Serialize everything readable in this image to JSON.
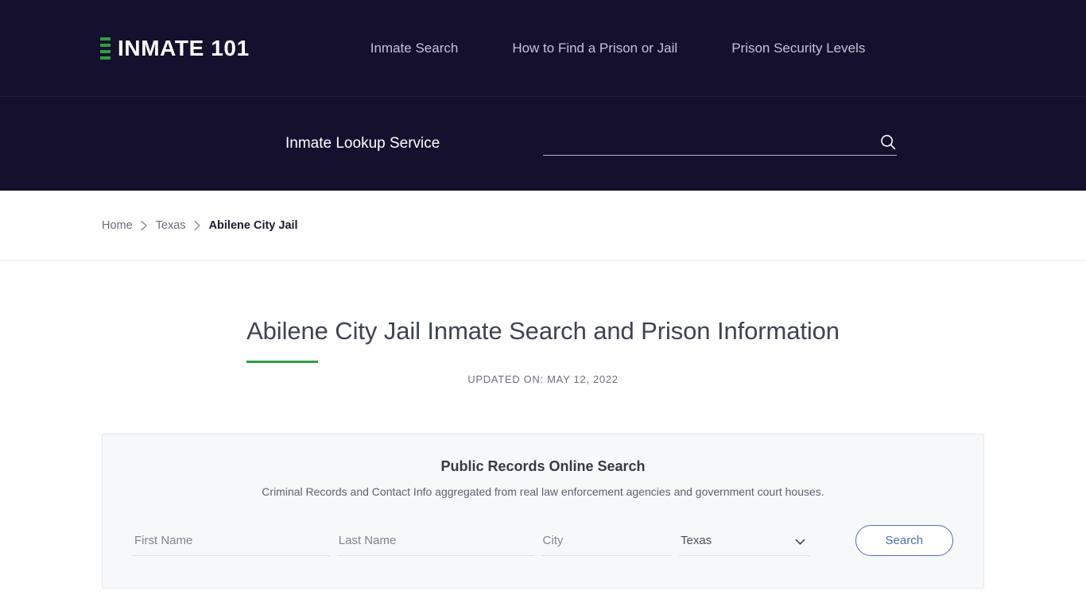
{
  "header": {
    "brand_text": "INMATE 101",
    "brand_icon": "bars-logo-icon",
    "nav": [
      {
        "label": "Inmate Search"
      },
      {
        "label": "How to Find a Prison or Jail"
      },
      {
        "label": "Prison Security Levels"
      }
    ]
  },
  "search_strip": {
    "label": "Inmate Lookup Service",
    "input_value": "",
    "input_placeholder": "",
    "search_icon": "search-icon"
  },
  "breadcrumb": {
    "items": [
      {
        "label": "Home"
      },
      {
        "label": "Texas"
      },
      {
        "label": "Abilene City Jail"
      }
    ],
    "separator_icon": "chevron-right-icon"
  },
  "page": {
    "title": "Abilene City Jail Inmate Search and Prison Information",
    "updated": "UPDATED ON: MAY 12, 2022",
    "accent_color": "#2f9e41"
  },
  "records": {
    "title": "Public Records Online Search",
    "subtitle": "Criminal Records and Contact Info aggregated from real law enforcement agencies and government court houses.",
    "fields": {
      "first_name": {
        "value": "",
        "placeholder": "First Name"
      },
      "last_name": {
        "value": "",
        "placeholder": "Last Name"
      },
      "city": {
        "value": "",
        "placeholder": "City"
      },
      "state": {
        "selected": "Texas",
        "chevron_icon": "chevron-down-icon"
      }
    },
    "submit_label": "Search",
    "submit_color": "#4a6fb5"
  }
}
